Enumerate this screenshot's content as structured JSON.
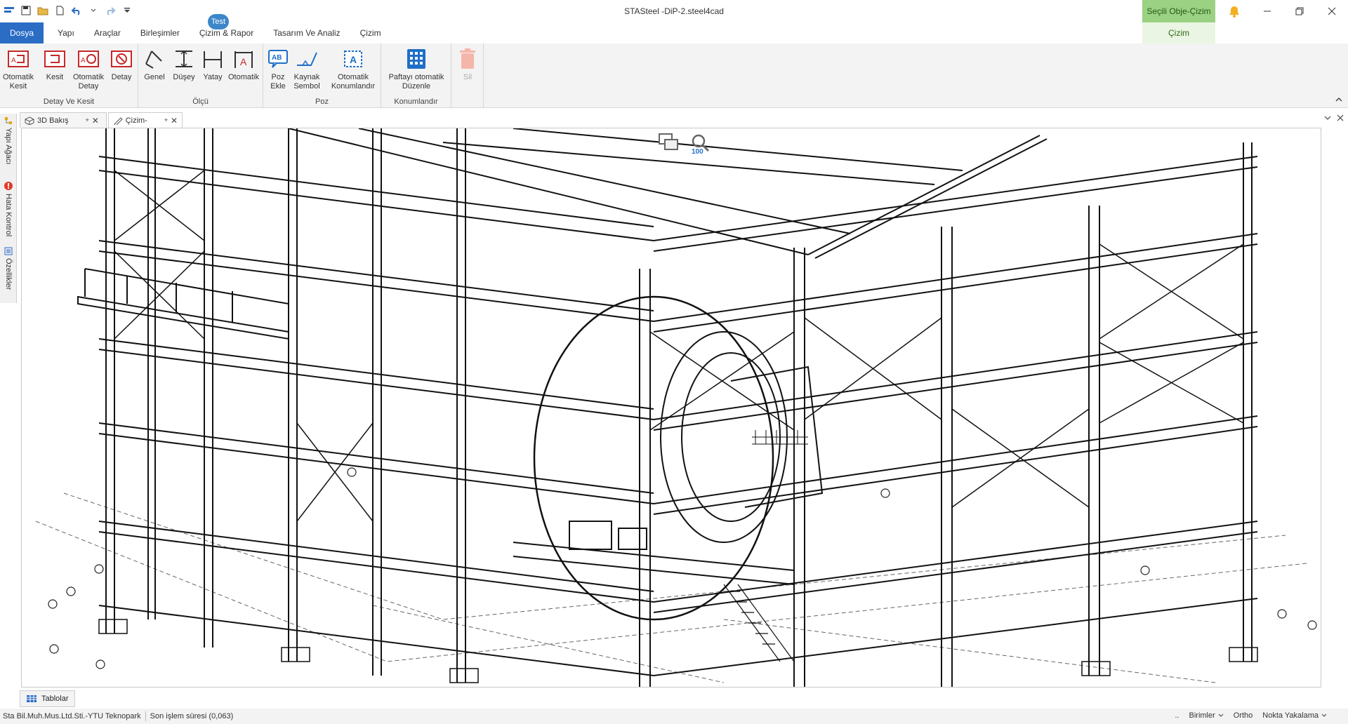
{
  "window": {
    "title": "STASteel -DiP-2.steel4cad"
  },
  "context_tab": {
    "label": "Seçili Obje-Çizim",
    "sub_label": "Çizim"
  },
  "test_badge": "Test",
  "tabs": [
    {
      "label": "Dosya"
    },
    {
      "label": "Yapı"
    },
    {
      "label": "Araçlar"
    },
    {
      "label": "Birleşimler"
    },
    {
      "label": "Çizim & Rapor"
    },
    {
      "label": "Tasarım Ve Analiz"
    },
    {
      "label": "Çizim"
    }
  ],
  "ribbon": {
    "groups": [
      {
        "label": "Detay Ve Kesit",
        "buttons": [
          {
            "label1": "Otomatik",
            "label2": "Kesit"
          },
          {
            "label1": "Kesit",
            "label2": ""
          },
          {
            "label1": "Otomatik",
            "label2": "Detay"
          },
          {
            "label1": "Detay",
            "label2": ""
          }
        ]
      },
      {
        "label": "Ölçü",
        "buttons": [
          {
            "label1": "Genel",
            "label2": ""
          },
          {
            "label1": "Düşey",
            "label2": ""
          },
          {
            "label1": "Yatay",
            "label2": ""
          },
          {
            "label1": "Otomatik",
            "label2": ""
          }
        ]
      },
      {
        "label": "Poz",
        "buttons": [
          {
            "label1": "Poz",
            "label2": "Ekle"
          },
          {
            "label1": "Kaynak",
            "label2": "Sembol"
          },
          {
            "label1": "Otomatik",
            "label2": "Konumlandır"
          }
        ]
      },
      {
        "label": "Konumlandır",
        "buttons": [
          {
            "label1": "Paftayı otomatik",
            "label2": "Düzenle"
          }
        ]
      },
      {
        "label": "",
        "buttons": [
          {
            "label1": "Sil",
            "label2": ""
          }
        ]
      }
    ]
  },
  "doc_tabs": [
    {
      "label": "3D Bakış"
    },
    {
      "label": "Çizim-"
    }
  ],
  "left_panel": [
    {
      "label": "Yapı Ağacı"
    },
    {
      "label": "Hata Kontrol"
    },
    {
      "label": "Özellikler"
    }
  ],
  "viewport": {
    "zoom_label": "100"
  },
  "bottom": {
    "tablolar": "Tablolar"
  },
  "status": {
    "company": "Sta Bil.Muh.Mus.Ltd.Sti.-YTU Teknopark",
    "last_op": "Son işlem süresi (0,063)",
    "ellipsis": "..",
    "units": "Birimler",
    "ortho": "Ortho",
    "snap": "Nokta Yakalama"
  },
  "colors": {
    "accent": "#2b6cc4",
    "context": "#9bd183",
    "icon_red": "#c62828",
    "icon_blue": "#1e6fc8"
  }
}
